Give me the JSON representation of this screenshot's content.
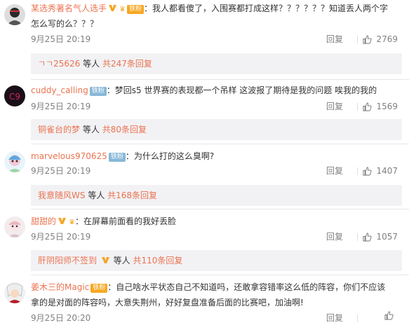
{
  "comments": [
    {
      "user": "某选秀著名气人选手",
      "has_v": true,
      "fan_badge": "铁粉",
      "fan_badge_color": "#f7a823",
      "has_crown": true,
      "text1": "我人都看傻了，入围赛都打成这样？？？？？？知道丢人两个字",
      "text2": "怎么写的么？？？",
      "time": "9月25日 20:19",
      "reply_label": "回复",
      "likes": "2769",
      "reply_preview": {
        "who": "ㄱㄱ25626",
        "etc": "等人",
        "count": "共247条回复"
      }
    },
    {
      "user": "cuddy_calling",
      "has_v": false,
      "fan_badge": "铁粉",
      "fan_badge_color": "#88b8d8",
      "has_crown": false,
      "text1": "梦回s5  世界赛的表现都一个吊样  这波报了期待是我的问题  唉我的我的",
      "text2": "",
      "time": "9月25日 20:19",
      "reply_label": "回复",
      "likes": "1569",
      "reply_preview": {
        "who": "铜雀台的梦",
        "etc": "等人",
        "count": "共80条回复"
      }
    },
    {
      "user": "marvelous970625",
      "has_v": false,
      "fan_badge": "铁粉",
      "fan_badge_color": "#88b8d8",
      "has_crown": false,
      "text1": "为什么打的这么臭啊?",
      "text2": "",
      "time": "9月25日 20:19",
      "reply_label": "回复",
      "likes": "1407",
      "reply_preview": {
        "who": "我意随风WS",
        "etc": "等人",
        "count": "共168条回复"
      }
    },
    {
      "user": "甜甜的",
      "has_v": true,
      "fan_badge": "",
      "fan_badge_color": "",
      "has_crown": true,
      "text1": "在屏幕前面看的我好丢脸",
      "text2": "",
      "time": "9月25日 20:19",
      "reply_label": "回复",
      "likes": "1057",
      "reply_preview": {
        "who": "肝阴阳师不签到",
        "etc": "等人",
        "count": "共110条回复"
      }
    },
    {
      "user": "姜木三的Magic",
      "has_v": false,
      "fan_badge": "铁粉",
      "fan_badge_color": "#f7a823",
      "has_crown": false,
      "text1": "自己啥水平状态自己不知道吗，还敢拿容错率这么低的阵容，你们不应该",
      "text2": "拿的是对面的阵容吗，大意失荆州，好好复盘准备后面的比赛吧，加油啊!",
      "time": "9月25日 20:20",
      "reply_label": "回复",
      "likes": "",
      "reply_preview": null
    }
  ]
}
